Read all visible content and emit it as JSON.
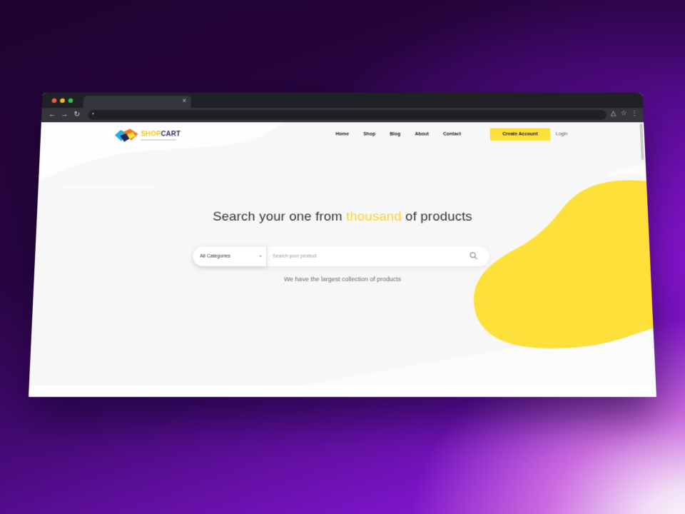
{
  "browser": {
    "tab_close": "×",
    "icons": [
      "back-arrow-icon",
      "forward-arrow-icon",
      "reload-icon",
      "lock-icon",
      "share-icon",
      "star-icon",
      "kebab-menu-icon"
    ]
  },
  "brand": {
    "name_part1": "SHOP",
    "name_part2": "CART",
    "colors": {
      "yellow": "#FDE03A",
      "navy": "#1E2A5A",
      "orange": "#F47B20",
      "blue": "#27AAE1"
    }
  },
  "nav": {
    "items": [
      "Home",
      "Shop",
      "Blog",
      "About",
      "Contact"
    ],
    "cta": "Create Account",
    "login": "Login"
  },
  "hero": {
    "title_before": "Search your one from ",
    "title_highlight": "thousand",
    "title_after": " of products",
    "category_select": "All Categories",
    "search_placeholder": "Search your product",
    "subtitle": "We have the largest collection of products"
  }
}
